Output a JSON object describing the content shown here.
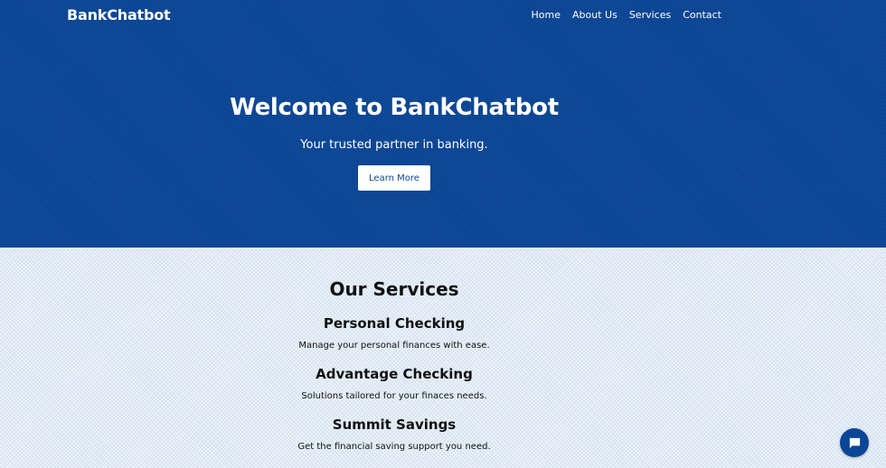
{
  "header": {
    "brand": "BankChatbot",
    "nav": [
      "Home",
      "About Us",
      "Services",
      "Contact"
    ]
  },
  "hero": {
    "title": "Welcome to BankChatbot",
    "subtitle": "Your trusted partner in banking.",
    "button_label": "Learn More"
  },
  "services": {
    "title": "Our Services",
    "items": [
      {
        "name": "Personal Checking",
        "description": "Manage your personal finances with ease."
      },
      {
        "name": "Advantage Checking",
        "description": "Solutions tailored for your finaces needs."
      },
      {
        "name": "Summit Savings",
        "description": "Get the financial saving support you need."
      }
    ]
  },
  "chat_widget": {
    "icon": "chat-bubble-icon"
  },
  "colors": {
    "primary": "#0b4696",
    "light_bg": "#e1ebf5",
    "text": "#111111"
  }
}
